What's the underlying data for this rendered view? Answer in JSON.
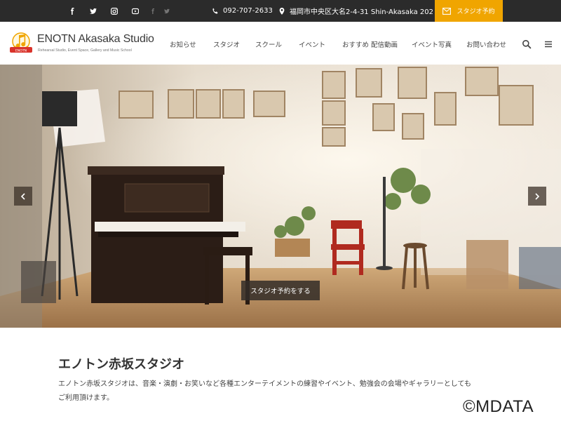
{
  "topbar": {
    "social_icons": [
      "facebook-icon",
      "twitter-icon",
      "instagram-icon",
      "youtube-icon",
      "facebook-icon",
      "twitter-icon"
    ],
    "phone": "092-707-2633",
    "address": "福岡市中央区大名2-4-31 Shin-Akasaka 202",
    "booking_label": "スタジオ予約",
    "accent_color": "#f0a500"
  },
  "header": {
    "logo_title": "ENOTN Akasaka Studio",
    "logo_subtitle": "Rehearsal Studio, Event Space, Gallery and Music School",
    "nav": [
      {
        "label": "お知らせ"
      },
      {
        "label": "スタジオ"
      },
      {
        "label": "スクール"
      },
      {
        "label": "イベント"
      },
      {
        "label": "おすすめ 配信動画"
      },
      {
        "label": "イベント写真"
      },
      {
        "label": "お問い合わせ"
      }
    ],
    "icons": [
      "search-icon",
      "menu-icon"
    ]
  },
  "hero": {
    "cta_label": "スタジオ予約をする"
  },
  "content": {
    "title": "エノトン赤坂スタジオ",
    "desc_line1": "エノトン赤坂スタジオは、音楽・演劇・お笑いなど各種エンターテイメントの練習やイベント、勉強会の会場やギャラリーとしても",
    "desc_line2": "ご利用頂けます。"
  },
  "watermark": "©MDATA"
}
